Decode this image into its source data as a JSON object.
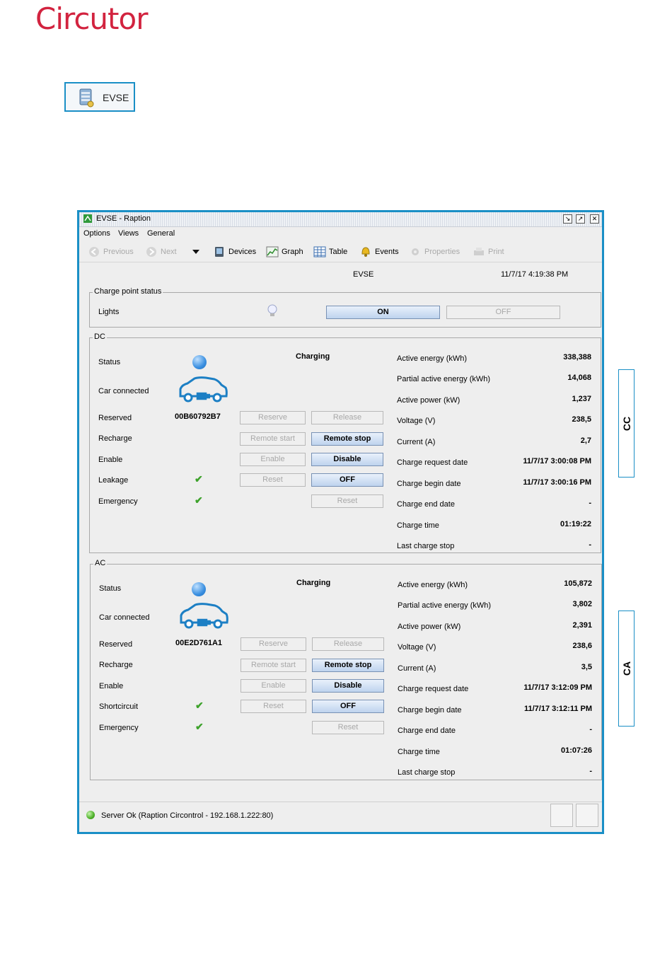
{
  "brand": {
    "logo": "Circutor"
  },
  "badge": {
    "label": "EVSE"
  },
  "window": {
    "title": "EVSE - Raption",
    "menu": [
      "Options",
      "Views",
      "General"
    ],
    "toolbar": {
      "previous": "Previous",
      "next": "Next",
      "devices": "Devices",
      "graph": "Graph",
      "table": "Table",
      "events": "Events",
      "properties": "Properties",
      "print": "Print"
    },
    "header": {
      "device": "EVSE",
      "datetime": "11/7/17 4:19:38 PM"
    }
  },
  "charge_point": {
    "group_label": "Charge point status",
    "lights_label": "Lights",
    "on_button": "ON",
    "off_button": "OFF"
  },
  "dc": {
    "group_label": "DC",
    "status_label": "Status",
    "status_value": "Charging",
    "car_label": "Car connected",
    "reserved_label": "Reserved",
    "reserved_value": "00B60792B7",
    "recharge_label": "Recharge",
    "enable_label": "Enable",
    "fault_label": "Leakage",
    "emergency_label": "Emergency",
    "buttons": {
      "reserve": "Reserve",
      "release": "Release",
      "remote_start": "Remote start",
      "remote_stop": "Remote stop",
      "enable": "Enable",
      "disable": "Disable",
      "reset": "Reset",
      "off": "OFF",
      "reset2": "Reset"
    },
    "metrics": [
      {
        "label": "Active energy (kWh)",
        "value": "338,388"
      },
      {
        "label": "Partial active energy (kWh)",
        "value": "14,068"
      },
      {
        "label": "Active power (kW)",
        "value": "1,237"
      },
      {
        "label": "Voltage (V)",
        "value": "238,5"
      },
      {
        "label": "Current (A)",
        "value": "2,7"
      },
      {
        "label": "Charge request date",
        "value": "11/7/17 3:00:08 PM"
      },
      {
        "label": "Charge begin date",
        "value": "11/7/17 3:00:16 PM"
      },
      {
        "label": "Charge end date",
        "value": "-"
      },
      {
        "label": "Charge time",
        "value": "01:19:22"
      },
      {
        "label": "Last charge stop",
        "value": "-"
      }
    ]
  },
  "ac": {
    "group_label": "AC",
    "status_label": "Status",
    "status_value": "Charging",
    "car_label": "Car connected",
    "reserved_label": "Reserved",
    "reserved_value": "00E2D761A1",
    "recharge_label": "Recharge",
    "enable_label": "Enable",
    "fault_label": "Shortcircuit",
    "emergency_label": "Emergency",
    "buttons": {
      "reserve": "Reserve",
      "release": "Release",
      "remote_start": "Remote start",
      "remote_stop": "Remote stop",
      "enable": "Enable",
      "disable": "Disable",
      "reset": "Reset",
      "off": "OFF",
      "reset2": "Reset"
    },
    "metrics": [
      {
        "label": "Active energy (kWh)",
        "value": "105,872"
      },
      {
        "label": "Partial active energy (kWh)",
        "value": "3,802"
      },
      {
        "label": "Active power (kW)",
        "value": "2,391"
      },
      {
        "label": "Voltage (V)",
        "value": "238,6"
      },
      {
        "label": "Current (A)",
        "value": "3,5"
      },
      {
        "label": "Charge request date",
        "value": "11/7/17 3:12:09 PM"
      },
      {
        "label": "Charge begin date",
        "value": "11/7/17 3:12:11 PM"
      },
      {
        "label": "Charge end date",
        "value": "-"
      },
      {
        "label": "Charge time",
        "value": "01:07:26"
      },
      {
        "label": "Last charge stop",
        "value": "-"
      }
    ]
  },
  "statusbar": {
    "text": "Server Ok (Raption Circontrol - 192.168.1.222:80)"
  },
  "side_tabs": {
    "cc": "CC",
    "ca": "CA"
  },
  "colors": {
    "brand": "#d2233f",
    "accent": "#1a8fc6",
    "ok": "#4db028"
  }
}
